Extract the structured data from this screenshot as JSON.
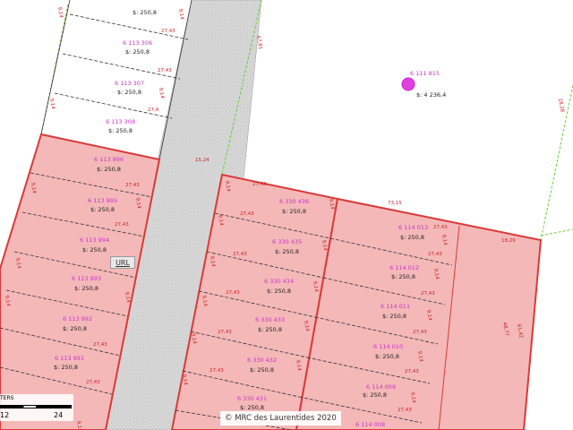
{
  "map": {
    "url_label": "URL",
    "attribution": "© MRC des Laurentides 2020",
    "scale": {
      "title": "TERS",
      "labels": [
        "12",
        "24"
      ]
    },
    "big_lot": {
      "number": "6 111 815",
      "area": "$: 4 236,4"
    },
    "top_lots": [
      {
        "number": "6 113 308",
        "area": "$: 250,8"
      },
      {
        "number": "6 113 307",
        "area": "$: 250,8"
      },
      {
        "number": "6 113 306",
        "area": "$: 250,8"
      },
      {
        "number": "",
        "area": "$: 250,8"
      }
    ],
    "left_lots": [
      {
        "number": "6 113 996",
        "area": "$: 250,8"
      },
      {
        "number": "6 113 995",
        "area": "$: 250,8"
      },
      {
        "number": "6 113 994",
        "area": "$: 250,8"
      },
      {
        "number": "6 113 993",
        "area": "$: 250,8"
      },
      {
        "number": "6 113 992",
        "area": "$: 250,8"
      },
      {
        "number": "6 113 991",
        "area": "$: 250,8"
      }
    ],
    "mid_lots": [
      {
        "number": "6 330 436",
        "area": "$: 250,8"
      },
      {
        "number": "6 330 435",
        "area": "$: 250,8"
      },
      {
        "number": "6 330 434",
        "area": "$: 250,8"
      },
      {
        "number": "6 330 433",
        "area": "$: 250,8"
      },
      {
        "number": "6 330 432",
        "area": "$: 250,8"
      },
      {
        "number": "6 330 431",
        "area": "$: 250,8"
      }
    ],
    "right_lots": [
      {
        "number": "6 114 013",
        "area": "$: 250,8"
      },
      {
        "number": "6 114 012",
        "area": "$: 250,8"
      },
      {
        "number": "6 114 011",
        "area": "$: 250,8"
      },
      {
        "number": "6 114 010",
        "area": "$: 250,8"
      },
      {
        "number": "6 114 009",
        "area": "$: 250,8"
      },
      {
        "number": "6 114 008",
        "area": ""
      }
    ],
    "dimensions": {
      "d27_43": "27,43",
      "d9_14": "9,14",
      "d27_4": "27,4",
      "d73_15": "73,15",
      "d18_29": "18,29",
      "d18_28": "18,28",
      "d15_24": "15,24",
      "d67_81": "67,81",
      "d48_77": "48,77",
      "d61_42": "61,42"
    },
    "colors": {
      "lot_fill": "#f4b8b8",
      "lot_border": "#d93a3a",
      "road": "#d2d2d2",
      "marker": "#e040e0",
      "lot_line": "#8a8a8a",
      "green_line": "#66cc33"
    }
  }
}
